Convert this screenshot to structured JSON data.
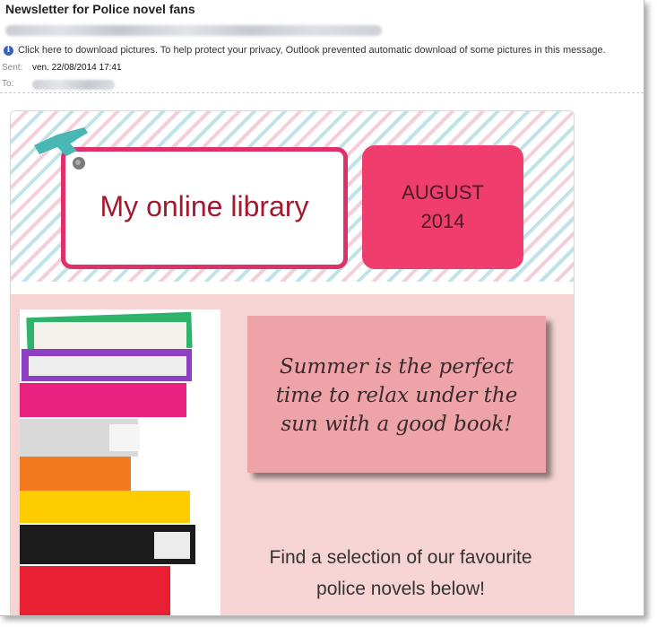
{
  "email": {
    "subject": "Newsletter for Police novel fans",
    "privacy_notice": "Click here to download pictures. To help protect your privacy, Outlook prevented automatic download of some pictures in this message.",
    "sent_label": "Sent:",
    "sent_value": "ven. 22/08/2014 17:41",
    "to_label": "To:"
  },
  "newsletter": {
    "title": "My online library",
    "month": "AUGUST",
    "year": "2014",
    "quote": "Summer is the perfect time to relax under the sun with a good book!",
    "cta": "Find a selection of our favourite police novels below!"
  },
  "colors": {
    "title_border": "#e0306a",
    "title_text": "#a4182e",
    "date_box": "#ef3d6e",
    "section_bg": "#f7d4d4",
    "quote_bg": "#eea3a8"
  }
}
